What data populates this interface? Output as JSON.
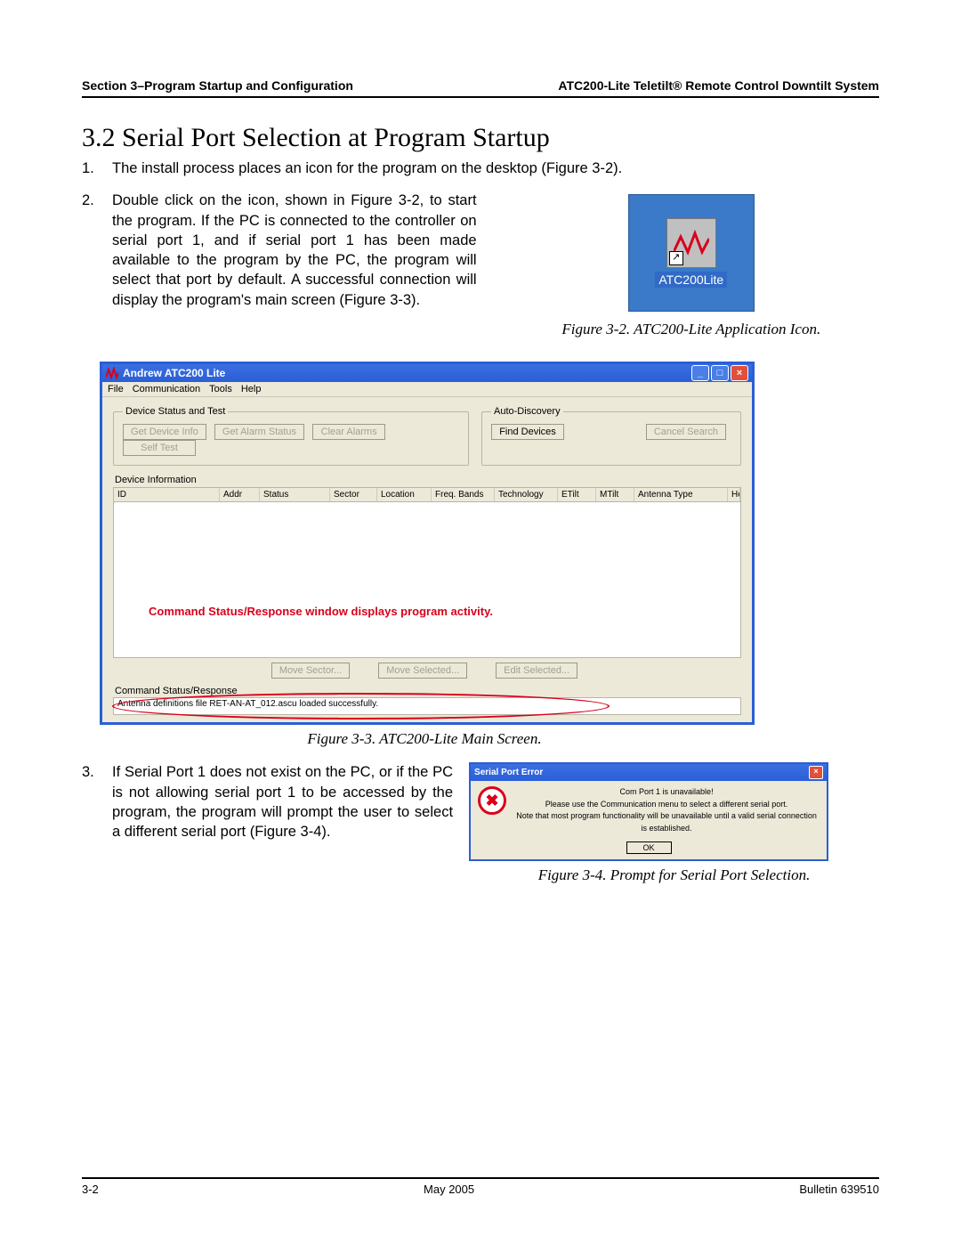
{
  "header": {
    "left": "Section 3–Program Startup and Configuration",
    "right": "ATC200-Lite Teletilt® Remote Control Downtilt System"
  },
  "section_title": "3.2 Serial Port Selection at Program Startup",
  "list": {
    "item1_num": "1.",
    "item1_text": "The install process places an icon for the program on the desktop (Figure 3-2).",
    "item2_num": "2.",
    "item2_text": "Double click on the icon, shown in Figure 3-2, to start the program. If the PC is connected to the controller on serial port 1, and if serial port 1 has been made available to the program by the PC, the program will select that port by default. A successful connection will display the program's main screen (Figure 3-3).",
    "item3_num": "3.",
    "item3_text": "If Serial Port 1 does not exist on the PC, or if the PC is not allowing serial port 1 to be accessed by the program, the program will prompt the user to select a different serial port (Figure 3-4)."
  },
  "icon": {
    "label": "ATC200Lite"
  },
  "captions": {
    "fig2": "Figure 3-2. ATC200-Lite Application Icon.",
    "fig3": "Figure 3-3. ATC200-Lite Main Screen.",
    "fig4": "Figure 3-4. Prompt for Serial Port Selection."
  },
  "app": {
    "title": "Andrew ATC200 Lite",
    "menu": {
      "file": "File",
      "comm": "Communication",
      "tools": "Tools",
      "help": "Help"
    },
    "group_status": "Device Status and Test",
    "group_auto": "Auto-Discovery",
    "btn": {
      "get_info": "Get Device Info",
      "get_alarm": "Get Alarm Status",
      "clear_alarms": "Clear Alarms",
      "self_test": "Self Test",
      "find": "Find Devices",
      "cancel": "Cancel Search",
      "move_sector": "Move Sector...",
      "move_selected": "Move Selected...",
      "edit_selected": "Edit Selected..."
    },
    "device_info_label": "Device Information",
    "columns": {
      "id": "ID",
      "addr": "Addr",
      "status": "Status",
      "sector": "Sector",
      "location": "Location",
      "freq": "Freq. Bands",
      "tech": "Technology",
      "etilt": "ETilt",
      "mtilt": "MTilt",
      "atype": "Antenna Type",
      "height": "Height"
    },
    "annotation": "Command Status/Response window displays program activity.",
    "status_label": "Command Status/Response",
    "status_text": "Antenna definitions file RET-AN-AT_012.ascu loaded successfully."
  },
  "error": {
    "title": "Serial Port Error",
    "line1": "Com Port 1 is unavailable!",
    "line2": "Please use the Communication menu to select a different serial port.",
    "line3": "Note that most program functionality will be unavailable until a valid serial connection is established.",
    "ok": "OK"
  },
  "footer": {
    "left": "3-2",
    "center": "May 2005",
    "right": "Bulletin 639510"
  }
}
